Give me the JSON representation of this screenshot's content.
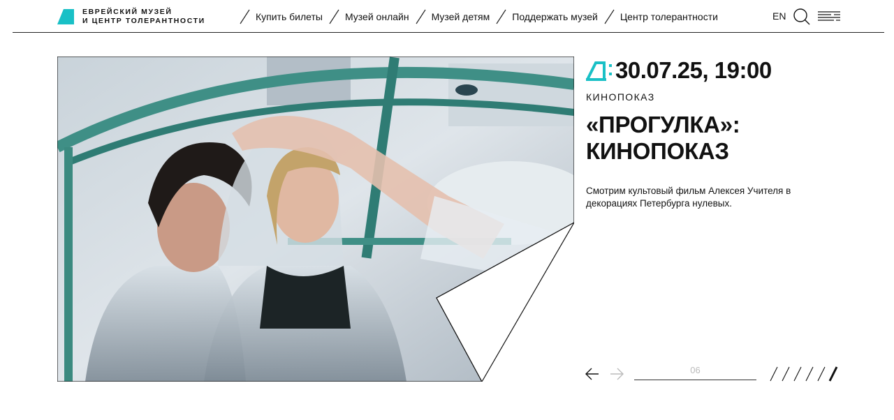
{
  "header": {
    "logo_line1": "ЕВРЕЙСКИЙ МУЗЕЙ",
    "logo_line2": "И ЦЕНТР ТОЛЕРАНТНОСТИ",
    "nav": [
      {
        "label": "Купить билеты"
      },
      {
        "label": "Музей онлайн"
      },
      {
        "label": "Музей детям"
      },
      {
        "label": "Поддержать музей"
      },
      {
        "label": "Центр толерантности"
      }
    ],
    "lang": "EN",
    "search_icon": "search-icon",
    "menu_icon": "hamburger-menu-icon"
  },
  "event": {
    "date": "30.07.25, 19:00",
    "category": "КИНОПОКАЗ",
    "title_line1": "«ПРОГУЛКА»:",
    "title_line2": "КИНОПОКАЗ",
    "description": "Смотрим культовый фильм Алексея Учителя в декорациях Петербурга нулевых."
  },
  "slider": {
    "current": "06",
    "total_slides": 6,
    "active_index": 5,
    "prev_icon": "arrow-left-icon",
    "next_icon": "arrow-right-icon"
  },
  "colors": {
    "accent": "#19c0c6",
    "text": "#111111",
    "muted": "#bbbbbb"
  }
}
